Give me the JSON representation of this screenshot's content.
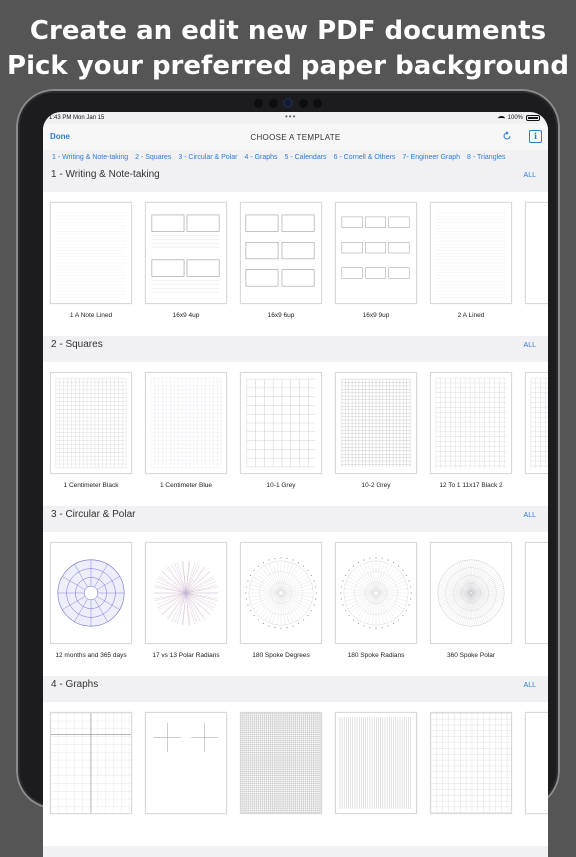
{
  "headline": {
    "line1": "Create an edit new PDF documents",
    "line2": "Pick your preferred paper background"
  },
  "status_bar": {
    "time_date": "1:43 PM   Mon Jan 15",
    "dots": "•••",
    "battery": "100%"
  },
  "nav": {
    "done": "Done",
    "title": "CHOOSE A TEMPLATE"
  },
  "tabs": [
    "1 - Writing & Note-taking",
    "2 - Squares",
    "3 - Circular & Polar",
    "4 - Graphs",
    "5 - Calendars",
    "6 - Cornell & Others",
    "7- Engineer Graph",
    "8 - Triangles"
  ],
  "sections": [
    {
      "title": "1 - Writing & Note-taking",
      "all": "ALL",
      "items": [
        "1 A Note Lined",
        "16x9 4up",
        "16x9 6up",
        "16x9 9up",
        "2 A Lined"
      ]
    },
    {
      "title": "2 - Squares",
      "all": "ALL",
      "items": [
        "1 Centimeter Black",
        "1 Centimeter Blue",
        "10-1 Grey",
        "10-2 Grey",
        "12 To 1 11x17 Black 2"
      ]
    },
    {
      "title": "3 - Circular & Polar",
      "all": "ALL",
      "items": [
        "12 months and 365 days",
        "17 vs 13 Polar Radians",
        "180 Spoke Degrees",
        "180 Spoke Radians",
        "360 Spoke Polar"
      ]
    },
    {
      "title": "4 - Graphs",
      "all": "ALL",
      "items": [
        "",
        "",
        "",
        "",
        ""
      ]
    }
  ],
  "colors": {
    "accent": "#2d7cd4",
    "background": "#555556",
    "device": "#1c1c1e"
  },
  "icons": {
    "refresh": "refresh-icon",
    "info": "info-icon",
    "wifi": "wifi-icon",
    "battery": "battery-icon"
  }
}
